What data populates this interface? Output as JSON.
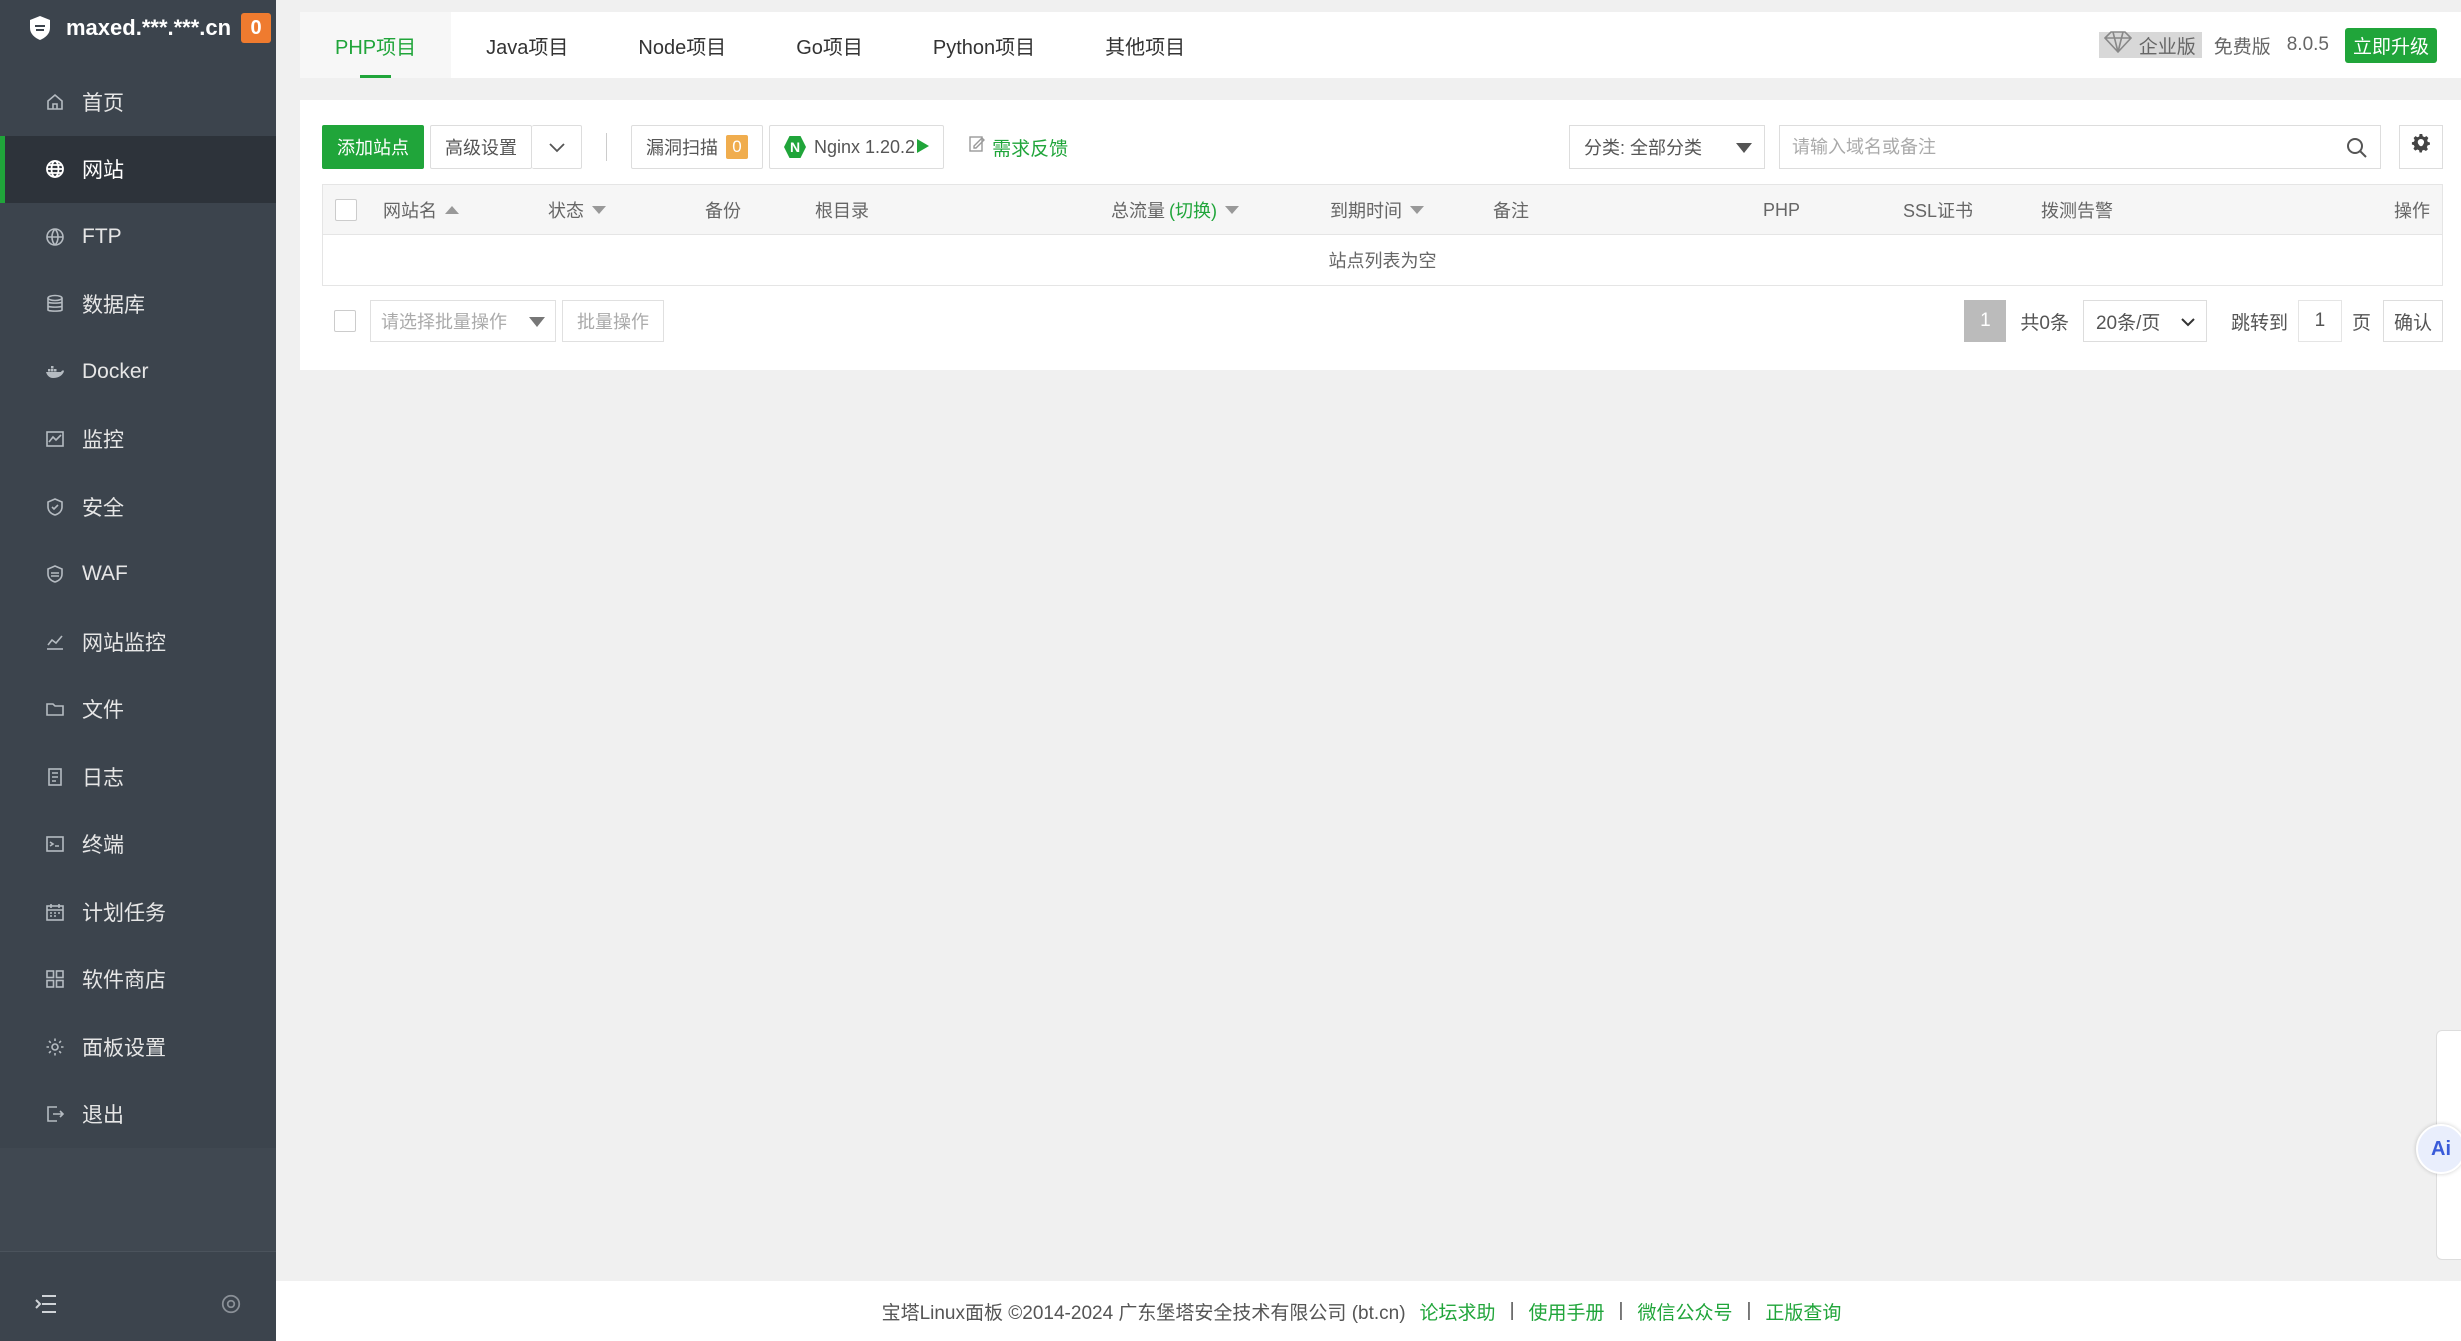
{
  "sidebar": {
    "host": "maxed.***.***.cn",
    "badge": "0",
    "items": [
      {
        "label": "首页",
        "icon": "home-icon"
      },
      {
        "label": "网站",
        "icon": "globe-icon",
        "active": true
      },
      {
        "label": "FTP",
        "icon": "ftp-icon"
      },
      {
        "label": "数据库",
        "icon": "database-icon"
      },
      {
        "label": "Docker",
        "icon": "docker-icon"
      },
      {
        "label": "监控",
        "icon": "monitor-icon"
      },
      {
        "label": "安全",
        "icon": "shield-icon"
      },
      {
        "label": "WAF",
        "icon": "waf-shield-icon"
      },
      {
        "label": "网站监控",
        "icon": "chart-line-icon"
      },
      {
        "label": "文件",
        "icon": "folder-icon"
      },
      {
        "label": "日志",
        "icon": "log-icon"
      },
      {
        "label": "终端",
        "icon": "terminal-icon"
      },
      {
        "label": "计划任务",
        "icon": "calendar-icon"
      },
      {
        "label": "软件商店",
        "icon": "apps-icon"
      },
      {
        "label": "面板设置",
        "icon": "gear-icon"
      },
      {
        "label": "退出",
        "icon": "logout-icon"
      }
    ]
  },
  "tabs": [
    "PHP项目",
    "Java项目",
    "Node项目",
    "Go项目",
    "Python项目",
    "其他项目"
  ],
  "top_right": {
    "enterprise": "企业版",
    "free": "免费版",
    "version": "8.0.5",
    "upgrade": "立即升级"
  },
  "toolbar": {
    "add_site": "添加站点",
    "advanced": "高级设置",
    "vuln_scan": "漏洞扫描",
    "vuln_count": "0",
    "nginx": "Nginx 1.20.2",
    "feedback": "需求反馈",
    "category": "分类: 全部分类",
    "search_placeholder": "请输入域名或备注"
  },
  "table": {
    "columns": {
      "name": "网站名",
      "status": "状态",
      "backup": "备份",
      "root": "根目录",
      "traffic": "总流量",
      "traffic_switch": "(切换)",
      "expire": "到期时间",
      "remark": "备注",
      "php": "PHP",
      "ssl": "SSL证书",
      "alert": "拨测告警",
      "action": "操作"
    },
    "empty": "站点列表为空"
  },
  "batch": {
    "placeholder": "请选择批量操作",
    "button": "批量操作"
  },
  "pager": {
    "current": "1",
    "total": "共0条",
    "page_size": "20条/页",
    "goto": "跳转到",
    "goto_value": "1",
    "page_unit": "页",
    "confirm": "确认"
  },
  "footer": {
    "copyright": "宝塔Linux面板 ©2014-2024 广东堡塔安全技术有限公司 (bt.cn)",
    "links": [
      "论坛求助",
      "使用手册",
      "微信公众号",
      "正版查询"
    ]
  },
  "colors": {
    "accent": "#20a53a",
    "sidebar_bg": "#3c444d",
    "badge": "#ef7b2f"
  }
}
